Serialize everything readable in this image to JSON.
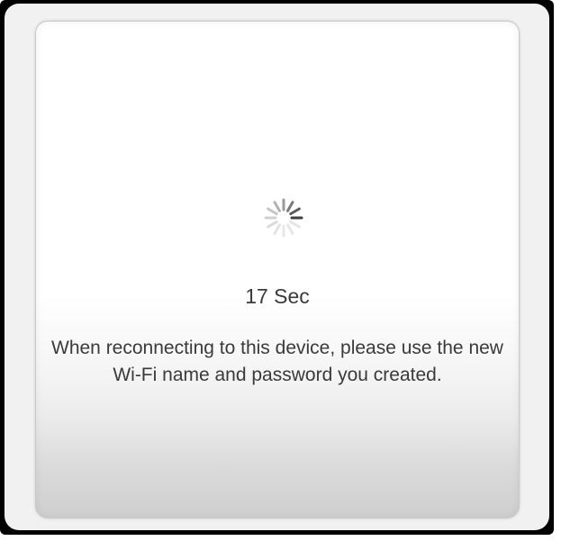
{
  "dialog": {
    "countdown": "17 Sec",
    "message": "When reconnecting to this device, please use the new Wi-Fi name and password you created.",
    "spinner_icon": "loading-spinner-icon"
  }
}
